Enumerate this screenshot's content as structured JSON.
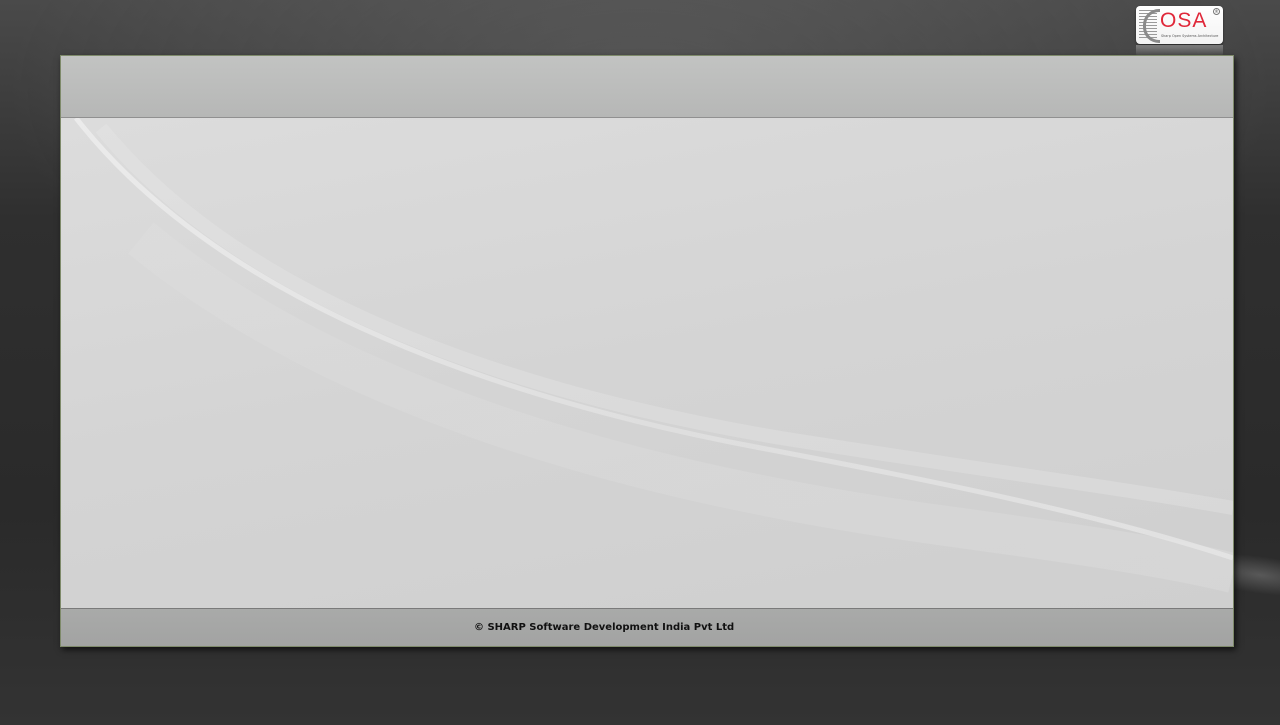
{
  "logo": {
    "text": "OSA",
    "subtitle": "Sharp Open Systems Architecture",
    "registered": "®"
  },
  "footer": {
    "copyright": "© SHARP Software Development India Pvt Ltd"
  }
}
